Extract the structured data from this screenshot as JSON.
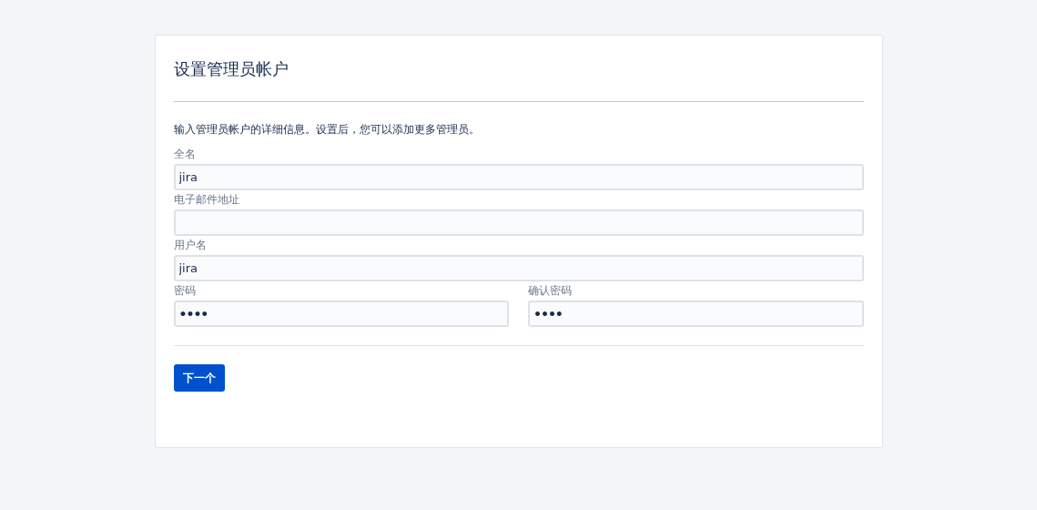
{
  "title": "设置管理员帐户",
  "description": "输入管理员帐户的详细信息。设置后，您可以添加更多管理员。",
  "rows": [
    {
      "fields": [
        {
          "label": "全名",
          "value": "jira",
          "kind": "text"
        }
      ]
    },
    {
      "fields": [
        {
          "label": "电子邮件地址",
          "kind": "text"
        }
      ]
    },
    {
      "fields": [
        {
          "label": "用户名",
          "value": "jira",
          "kind": "text"
        }
      ]
    },
    {
      "fields": [
        {
          "label": "密码",
          "value": "••••",
          "kind": "password"
        },
        {
          "label": "确认密码",
          "value": "••••",
          "kind": "password"
        }
      ]
    }
  ],
  "button": "下一个"
}
